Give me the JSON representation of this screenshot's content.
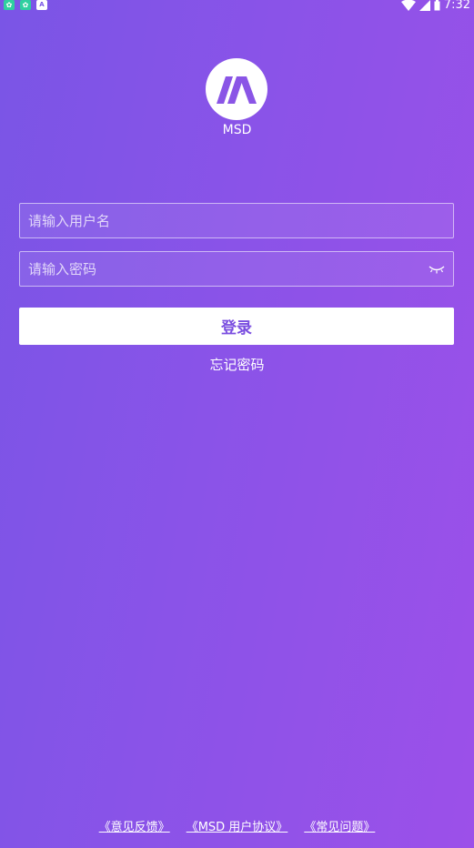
{
  "status_bar": {
    "time": "7:32",
    "left_icons": [
      "notification-icon",
      "notification-icon",
      "a-icon"
    ],
    "a_label": "A"
  },
  "app": {
    "name": "MSD"
  },
  "form": {
    "username_placeholder": "请输入用户名",
    "password_placeholder": "请输入密码",
    "login_label": "登录",
    "forgot_label": "忘记密码"
  },
  "footer": {
    "links": [
      "《意见反馈》",
      "《MSD 用户协议》",
      "《常见问题》"
    ]
  },
  "colors": {
    "accent": "#7b4fe0",
    "background_start": "#7a55e6",
    "background_end": "#9c50e9"
  }
}
